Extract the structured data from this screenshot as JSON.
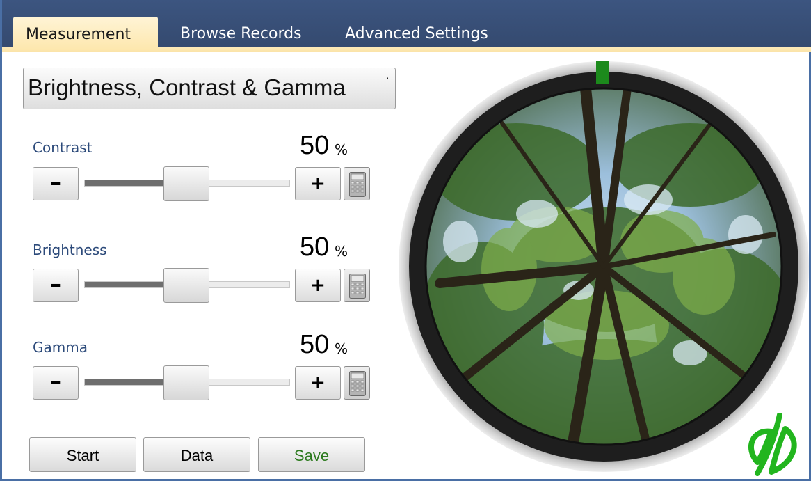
{
  "tabs": [
    {
      "label": "Measurement",
      "active": true
    },
    {
      "label": "Browse Records",
      "active": false
    },
    {
      "label": "Advanced Settings",
      "active": false
    }
  ],
  "mode_select": {
    "value": "Brightness, Contrast & Gamma",
    "arrow": "˙"
  },
  "sliders": [
    {
      "label": "Contrast",
      "value": "50",
      "unit": "%",
      "level": 0.5
    },
    {
      "label": "Brightness",
      "value": "50",
      "unit": "%",
      "level": 0.5
    },
    {
      "label": "Gamma",
      "value": "50",
      "unit": "%",
      "level": 0.5
    }
  ],
  "buttons": {
    "minus": "–",
    "plus": "+",
    "start": "Start",
    "data": "Data",
    "save": "Save"
  },
  "icons": {
    "calculator": "calculator-icon",
    "logo": "leaf-logo-icon",
    "indicator": "north-marker"
  },
  "colors": {
    "tab_bar": "#3c5580",
    "active_tab": "#fde7ad",
    "label": "#2c4a7a",
    "save": "#2c7a1e",
    "logo": "#22b51e",
    "marker": "#1c8a1c"
  }
}
